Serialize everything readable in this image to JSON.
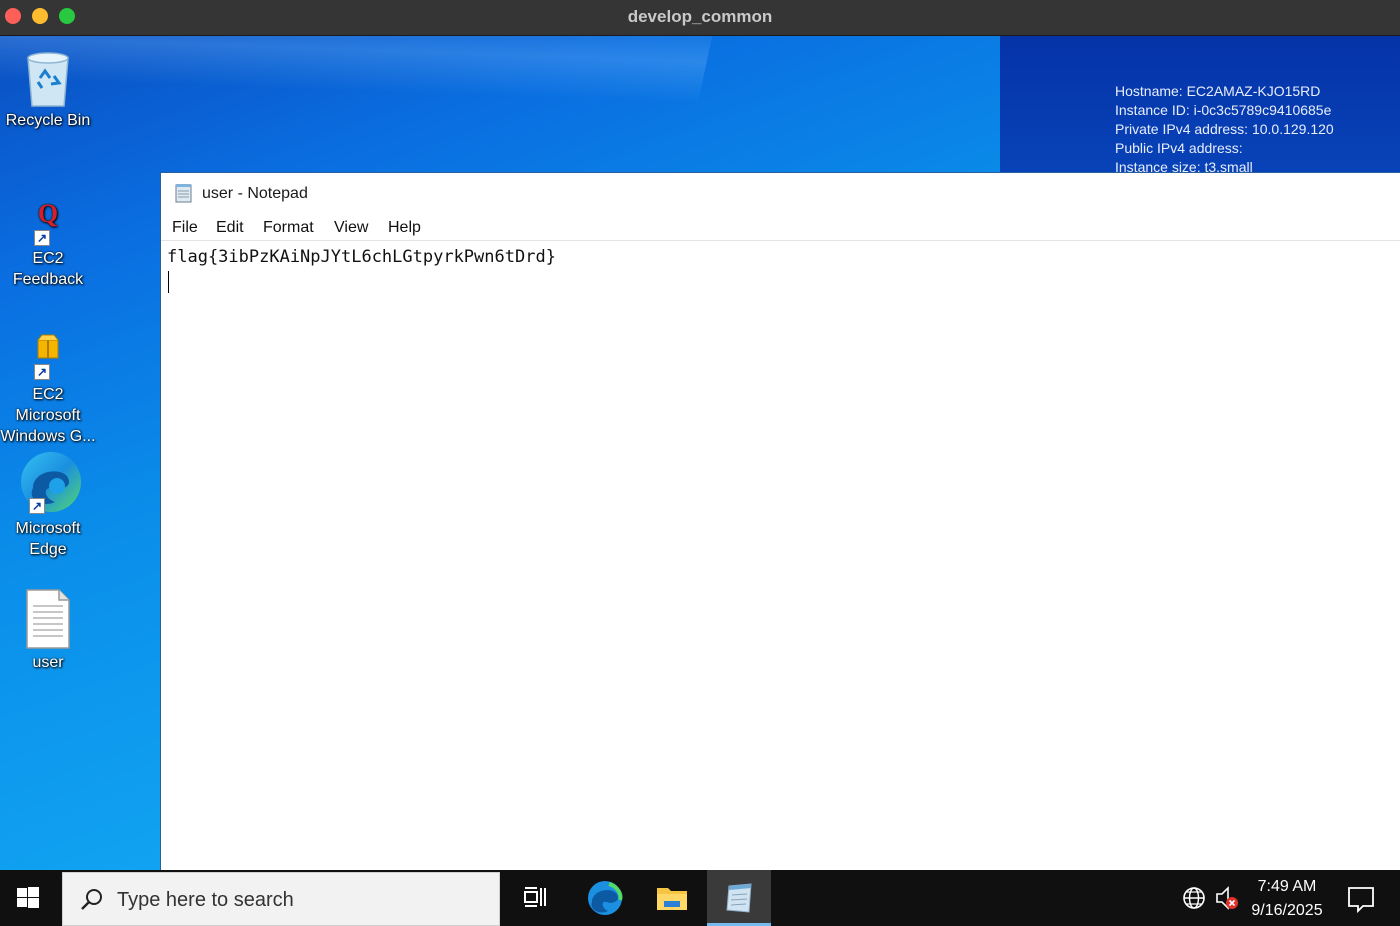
{
  "mac_window": {
    "title": "develop_common"
  },
  "desktop": {
    "icons": [
      {
        "label": "Recycle Bin",
        "icon": "recycle-bin-icon"
      },
      {
        "label": "EC2 Feedback",
        "icon": "feedback-icon"
      },
      {
        "label": "EC2 Microsoft Windows G...",
        "icon": "package-icon"
      },
      {
        "label": "Microsoft Edge",
        "icon": "edge-icon"
      },
      {
        "label": "user",
        "icon": "text-file-icon"
      }
    ],
    "instance_info": {
      "hostname": "Hostname: EC2AMAZ-KJO15RD",
      "instance_id": "Instance ID: i-0c3c5789c9410685e",
      "private_ip": "Private IPv4 address: 10.0.129.120",
      "public_ip": "Public IPv4 address:",
      "instance_size": "Instance size: t3.small"
    }
  },
  "notepad": {
    "title": "user - Notepad",
    "menu": [
      "File",
      "Edit",
      "Format",
      "View",
      "Help"
    ],
    "content": "flag{3ibPzKAiNpJYtL6chLGtpyrkPwn6tDrd}"
  },
  "taskbar": {
    "search_placeholder": "Type here to search",
    "time": "7:49 AM",
    "date": "9/16/2025"
  },
  "colors": {
    "accent": "#76b9ed",
    "taskbar": "#101010",
    "desktop_blue": "#0a8eea"
  }
}
